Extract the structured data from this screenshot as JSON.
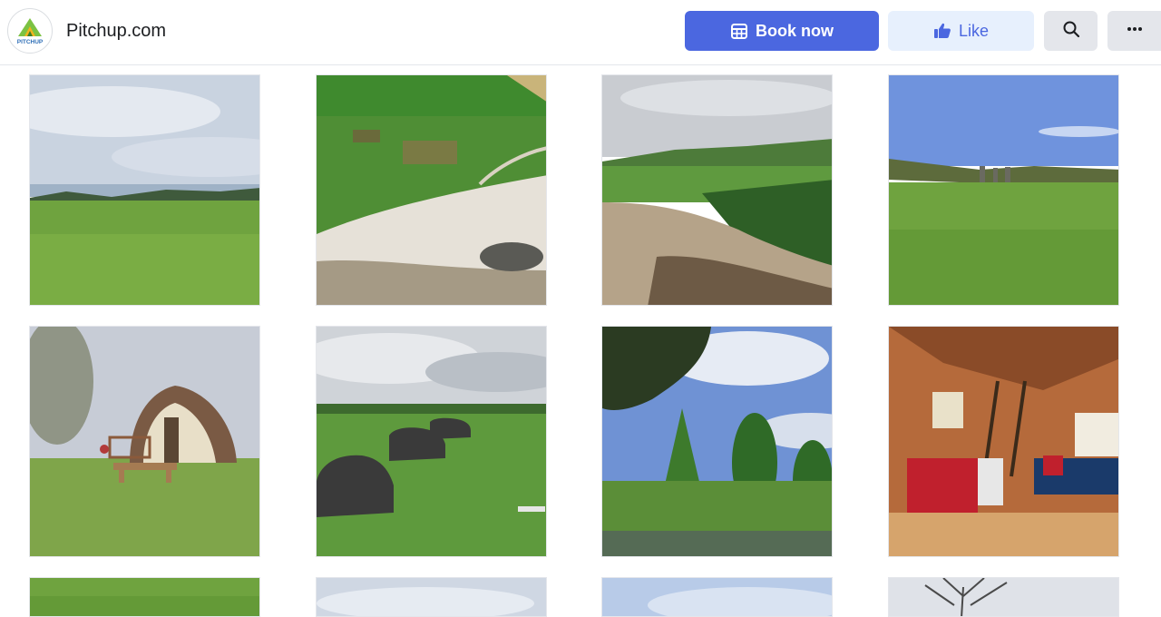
{
  "header": {
    "logo_text": "PITCHUP",
    "brand_name": "Pitchup.com",
    "book_label": "Book now",
    "like_label": "Like",
    "colors": {
      "accent": "#4b67e0",
      "like_bg": "#e7f0fd",
      "neutral_bg": "#e4e6eb"
    }
  },
  "icons": {
    "book": "calendar-icon",
    "like": "thumbs-up-icon",
    "search": "search-icon",
    "more": "more-dots-icon"
  },
  "gallery": {
    "photos": [
      {
        "subject": "coastal-meadow"
      },
      {
        "subject": "aerial-campsite-beach"
      },
      {
        "subject": "shoreline-fields"
      },
      {
        "subject": "standing-stones-field"
      },
      {
        "subject": "glamping-pod-bench"
      },
      {
        "subject": "pods-in-field"
      },
      {
        "subject": "trees-and-pond"
      },
      {
        "subject": "pod-interior"
      },
      {
        "subject": "grass-partial"
      },
      {
        "subject": "sky-partial"
      },
      {
        "subject": "sky-partial-2"
      },
      {
        "subject": "bare-tree-partial"
      }
    ]
  }
}
